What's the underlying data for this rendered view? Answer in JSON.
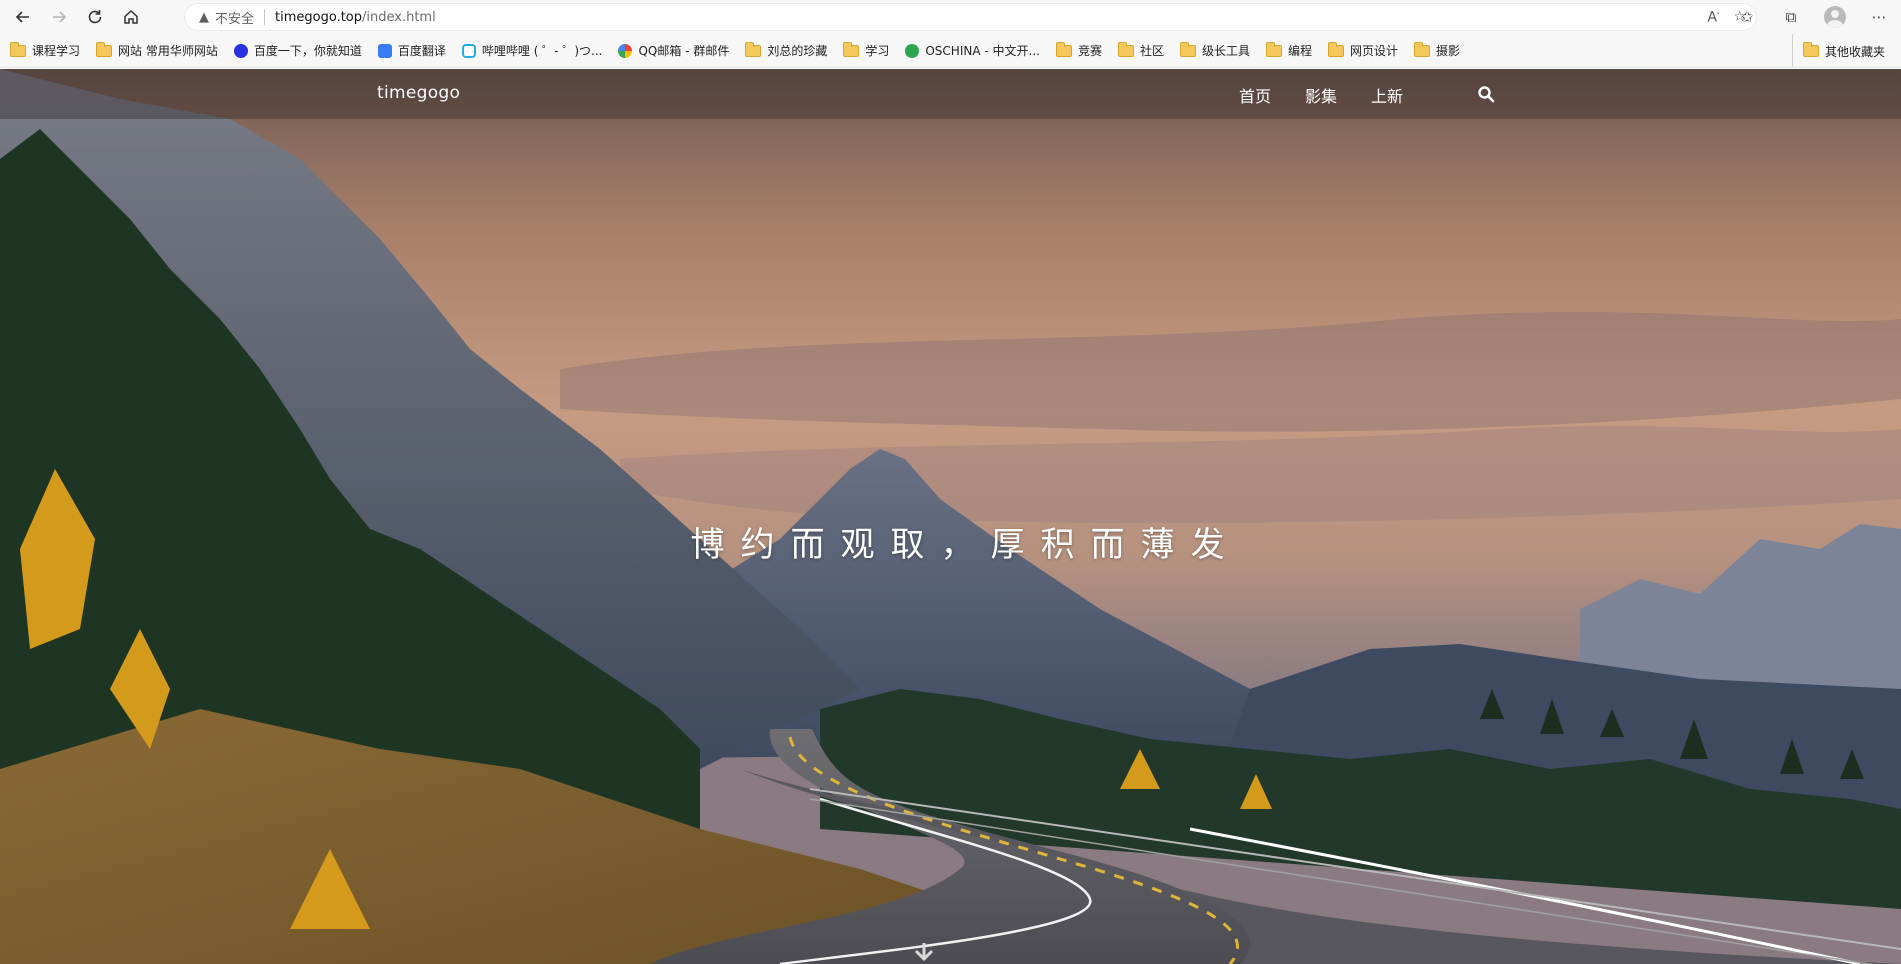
{
  "browser": {
    "address": {
      "security_label": "不安全",
      "host": "timegogo.top",
      "path": "/index.html"
    },
    "read_aloud_label": "A",
    "bookmarks": [
      {
        "label": "课程学习",
        "icon": "folder-icon"
      },
      {
        "label": "网站 常用华师网站",
        "icon": "folder-icon"
      },
      {
        "label": "百度一下，你就知道",
        "icon": "baidu-icon"
      },
      {
        "label": "百度翻译",
        "icon": "baidu-translate-icon"
      },
      {
        "label": "哔哩哔哩 ( ゜- ゜)つ...",
        "icon": "bilibili-icon"
      },
      {
        "label": "QQ邮箱 - 群邮件",
        "icon": "qqmail-icon"
      },
      {
        "label": "刘总的珍藏",
        "icon": "folder-icon"
      },
      {
        "label": "学习",
        "icon": "folder-icon"
      },
      {
        "label": "OSCHINA - 中文开...",
        "icon": "oschina-icon"
      },
      {
        "label": "竞赛",
        "icon": "folder-icon"
      },
      {
        "label": "社区",
        "icon": "folder-icon"
      },
      {
        "label": "级长工具",
        "icon": "folder-icon"
      },
      {
        "label": "编程",
        "icon": "folder-icon"
      },
      {
        "label": "网页设计",
        "icon": "folder-icon"
      },
      {
        "label": "摄影",
        "icon": "folder-icon"
      }
    ],
    "other_bookmarks_label": "其他收藏夹"
  },
  "site": {
    "brand": "timegogo",
    "menu": [
      "首页",
      "影集",
      "上新"
    ],
    "slogan": "博约而观取，厚积而薄发"
  }
}
